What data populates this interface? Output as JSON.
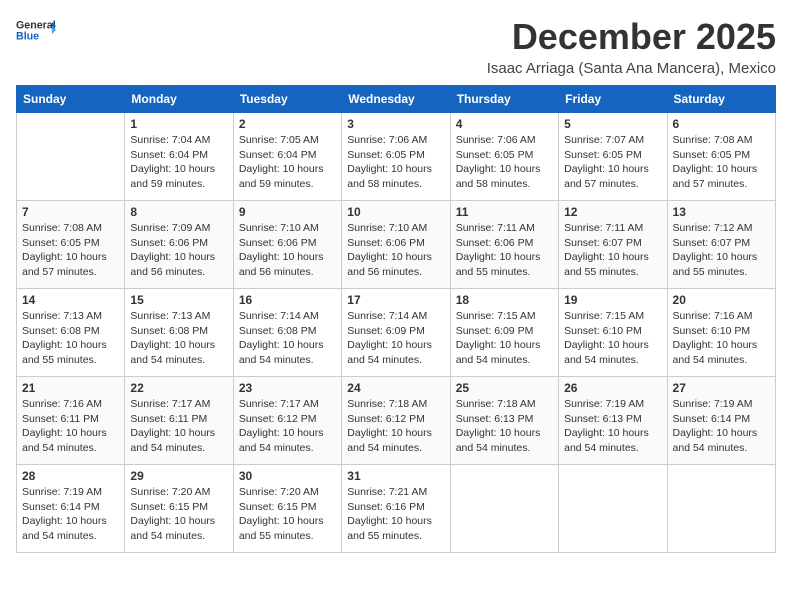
{
  "header": {
    "logo_line1": "General",
    "logo_line2": "Blue",
    "month": "December 2025",
    "location": "Isaac Arriaga (Santa Ana Mancera), Mexico"
  },
  "weekdays": [
    "Sunday",
    "Monday",
    "Tuesday",
    "Wednesday",
    "Thursday",
    "Friday",
    "Saturday"
  ],
  "weeks": [
    [
      {
        "day": "",
        "info": ""
      },
      {
        "day": "1",
        "info": "Sunrise: 7:04 AM\nSunset: 6:04 PM\nDaylight: 10 hours\nand 59 minutes."
      },
      {
        "day": "2",
        "info": "Sunrise: 7:05 AM\nSunset: 6:04 PM\nDaylight: 10 hours\nand 59 minutes."
      },
      {
        "day": "3",
        "info": "Sunrise: 7:06 AM\nSunset: 6:05 PM\nDaylight: 10 hours\nand 58 minutes."
      },
      {
        "day": "4",
        "info": "Sunrise: 7:06 AM\nSunset: 6:05 PM\nDaylight: 10 hours\nand 58 minutes."
      },
      {
        "day": "5",
        "info": "Sunrise: 7:07 AM\nSunset: 6:05 PM\nDaylight: 10 hours\nand 57 minutes."
      },
      {
        "day": "6",
        "info": "Sunrise: 7:08 AM\nSunset: 6:05 PM\nDaylight: 10 hours\nand 57 minutes."
      }
    ],
    [
      {
        "day": "7",
        "info": "Sunrise: 7:08 AM\nSunset: 6:05 PM\nDaylight: 10 hours\nand 57 minutes."
      },
      {
        "day": "8",
        "info": "Sunrise: 7:09 AM\nSunset: 6:06 PM\nDaylight: 10 hours\nand 56 minutes."
      },
      {
        "day": "9",
        "info": "Sunrise: 7:10 AM\nSunset: 6:06 PM\nDaylight: 10 hours\nand 56 minutes."
      },
      {
        "day": "10",
        "info": "Sunrise: 7:10 AM\nSunset: 6:06 PM\nDaylight: 10 hours\nand 56 minutes."
      },
      {
        "day": "11",
        "info": "Sunrise: 7:11 AM\nSunset: 6:06 PM\nDaylight: 10 hours\nand 55 minutes."
      },
      {
        "day": "12",
        "info": "Sunrise: 7:11 AM\nSunset: 6:07 PM\nDaylight: 10 hours\nand 55 minutes."
      },
      {
        "day": "13",
        "info": "Sunrise: 7:12 AM\nSunset: 6:07 PM\nDaylight: 10 hours\nand 55 minutes."
      }
    ],
    [
      {
        "day": "14",
        "info": "Sunrise: 7:13 AM\nSunset: 6:08 PM\nDaylight: 10 hours\nand 55 minutes."
      },
      {
        "day": "15",
        "info": "Sunrise: 7:13 AM\nSunset: 6:08 PM\nDaylight: 10 hours\nand 54 minutes."
      },
      {
        "day": "16",
        "info": "Sunrise: 7:14 AM\nSunset: 6:08 PM\nDaylight: 10 hours\nand 54 minutes."
      },
      {
        "day": "17",
        "info": "Sunrise: 7:14 AM\nSunset: 6:09 PM\nDaylight: 10 hours\nand 54 minutes."
      },
      {
        "day": "18",
        "info": "Sunrise: 7:15 AM\nSunset: 6:09 PM\nDaylight: 10 hours\nand 54 minutes."
      },
      {
        "day": "19",
        "info": "Sunrise: 7:15 AM\nSunset: 6:10 PM\nDaylight: 10 hours\nand 54 minutes."
      },
      {
        "day": "20",
        "info": "Sunrise: 7:16 AM\nSunset: 6:10 PM\nDaylight: 10 hours\nand 54 minutes."
      }
    ],
    [
      {
        "day": "21",
        "info": "Sunrise: 7:16 AM\nSunset: 6:11 PM\nDaylight: 10 hours\nand 54 minutes."
      },
      {
        "day": "22",
        "info": "Sunrise: 7:17 AM\nSunset: 6:11 PM\nDaylight: 10 hours\nand 54 minutes."
      },
      {
        "day": "23",
        "info": "Sunrise: 7:17 AM\nSunset: 6:12 PM\nDaylight: 10 hours\nand 54 minutes."
      },
      {
        "day": "24",
        "info": "Sunrise: 7:18 AM\nSunset: 6:12 PM\nDaylight: 10 hours\nand 54 minutes."
      },
      {
        "day": "25",
        "info": "Sunrise: 7:18 AM\nSunset: 6:13 PM\nDaylight: 10 hours\nand 54 minutes."
      },
      {
        "day": "26",
        "info": "Sunrise: 7:19 AM\nSunset: 6:13 PM\nDaylight: 10 hours\nand 54 minutes."
      },
      {
        "day": "27",
        "info": "Sunrise: 7:19 AM\nSunset: 6:14 PM\nDaylight: 10 hours\nand 54 minutes."
      }
    ],
    [
      {
        "day": "28",
        "info": "Sunrise: 7:19 AM\nSunset: 6:14 PM\nDaylight: 10 hours\nand 54 minutes."
      },
      {
        "day": "29",
        "info": "Sunrise: 7:20 AM\nSunset: 6:15 PM\nDaylight: 10 hours\nand 54 minutes."
      },
      {
        "day": "30",
        "info": "Sunrise: 7:20 AM\nSunset: 6:15 PM\nDaylight: 10 hours\nand 55 minutes."
      },
      {
        "day": "31",
        "info": "Sunrise: 7:21 AM\nSunset: 6:16 PM\nDaylight: 10 hours\nand 55 minutes."
      },
      {
        "day": "",
        "info": ""
      },
      {
        "day": "",
        "info": ""
      },
      {
        "day": "",
        "info": ""
      }
    ]
  ]
}
